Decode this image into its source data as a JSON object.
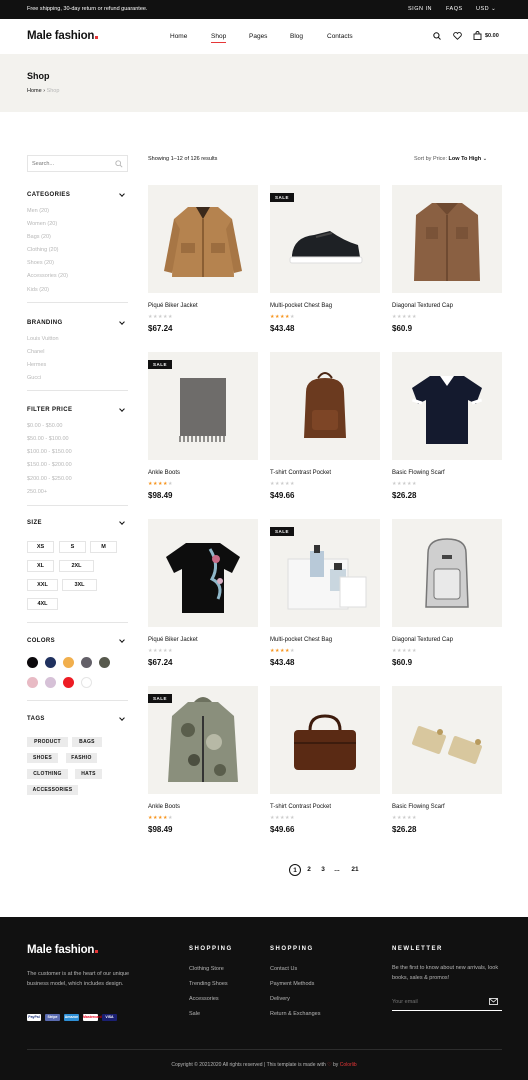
{
  "topbar": {
    "message": "Free shipping, 30-day return or refund guarantee.",
    "sign_in": "SIGN IN",
    "faqs": "FAQS",
    "currency": "USD"
  },
  "header": {
    "logo": "Male fashion",
    "nav": [
      "Home",
      "Shop",
      "Pages",
      "Blog",
      "Contacts"
    ],
    "active_nav": "Shop",
    "cart_total": "$0.00"
  },
  "banner": {
    "title": "Shop",
    "breadcrumb_home": "Home",
    "breadcrumb_current": "Shop"
  },
  "sidebar": {
    "search_placeholder": "Search...",
    "categories_title": "CATEGORIES",
    "categories": [
      "Men (20)",
      "Women (20)",
      "Bags (20)",
      "Clothing (20)",
      "Shoes (20)",
      "Accessories (20)",
      "Kids (20)"
    ],
    "branding_title": "BRANDING",
    "brands": [
      "Louis Vuitton",
      "Chanel",
      "Hermes",
      "Gucci"
    ],
    "price_title": "FILTER PRICE",
    "prices": [
      "$0.00 - $50.00",
      "$50.00 - $100.00",
      "$100.00 - $150.00",
      "$150.00 - $200.00",
      "$200.00 - $250.00",
      "250.00+"
    ],
    "size_title": "SIZE",
    "sizes": [
      "XS",
      "S",
      "M",
      "XL",
      "2XL",
      "XXL",
      "3XL",
      "4XL"
    ],
    "colors_title": "COLORS",
    "colors": [
      "#0b090c",
      "#20315f",
      "#f1af4d",
      "#636068",
      "#57594d",
      "#e8bac4",
      "#d6c1d7",
      "#ed1c24",
      "#ffffff"
    ],
    "tags_title": "TAGS",
    "tags": [
      "PRODUCT",
      "BAGS",
      "SHOES",
      "FASHIO",
      "CLOTHING",
      "HATS",
      "ACCESSORIES"
    ]
  },
  "shop": {
    "showing": "Showing 1–12 of 126 results",
    "sort_label": "Sort by Price:",
    "sort_value": "Low To High"
  },
  "products": [
    {
      "name": "Piqué Biker Jacket",
      "price": "$67.24",
      "rating": 0,
      "sale": false,
      "image": "jacket-icon"
    },
    {
      "name": "Multi-pocket Chest Bag",
      "price": "$43.48",
      "rating": 4,
      "sale": true,
      "image": "sneaker-icon"
    },
    {
      "name": "Diagonal Textured Cap",
      "price": "$60.9",
      "rating": 0,
      "sale": false,
      "image": "shirt-icon"
    },
    {
      "name": "Ankle Boots",
      "price": "$98.49",
      "rating": 4,
      "sale": true,
      "image": "scarf-icon"
    },
    {
      "name": "T-shirt Contrast Pocket",
      "price": "$49.66",
      "rating": 0,
      "sale": false,
      "image": "backpack-icon"
    },
    {
      "name": "Basic Flowing Scarf",
      "price": "$26.28",
      "rating": 0,
      "sale": false,
      "image": "polo-icon"
    },
    {
      "name": "Piqué Biker Jacket",
      "price": "$67.24",
      "rating": 0,
      "sale": false,
      "image": "tshirt-icon"
    },
    {
      "name": "Multi-pocket Chest Bag",
      "price": "$43.48",
      "rating": 4,
      "sale": true,
      "image": "perfume-icon"
    },
    {
      "name": "Diagonal Textured Cap",
      "price": "$60.9",
      "rating": 0,
      "sale": false,
      "image": "grey-backpack-icon"
    },
    {
      "name": "Ankle Boots",
      "price": "$98.49",
      "rating": 4,
      "sale": true,
      "image": "camo-jacket-icon"
    },
    {
      "name": "T-shirt Contrast Pocket",
      "price": "$49.66",
      "rating": 0,
      "sale": false,
      "image": "briefcase-icon"
    },
    {
      "name": "Basic Flowing Scarf",
      "price": "$26.28",
      "rating": 0,
      "sale": false,
      "image": "cufflinks-icon"
    }
  ],
  "pagination": {
    "pages": [
      "1",
      "2",
      "3",
      "...",
      "21"
    ],
    "current": "1"
  },
  "footer": {
    "logo": "Male fashion",
    "about": "The customer is at the heart of our unique business model, which includes design.",
    "payments": [
      "PayPal",
      "Stripe",
      "Amazon",
      "Mastercard",
      "VISA"
    ],
    "col1_title": "SHOPPING",
    "col1_links": [
      "Clothing Store",
      "Trending Shoes",
      "Accessories",
      "Sale"
    ],
    "col2_title": "SHOPPING",
    "col2_links": [
      "Contact Us",
      "Payment Methods",
      "Delivery",
      "Return & Exchanges"
    ],
    "news_title": "NEWLETTER",
    "news_text": "Be the first to know about new arrivals, look books, sales & promos!",
    "news_placeholder": "Your email",
    "copyright": "Copyright © 20212020 All rights reserved | This template is made with",
    "by": "by",
    "author": "Colorlib"
  }
}
